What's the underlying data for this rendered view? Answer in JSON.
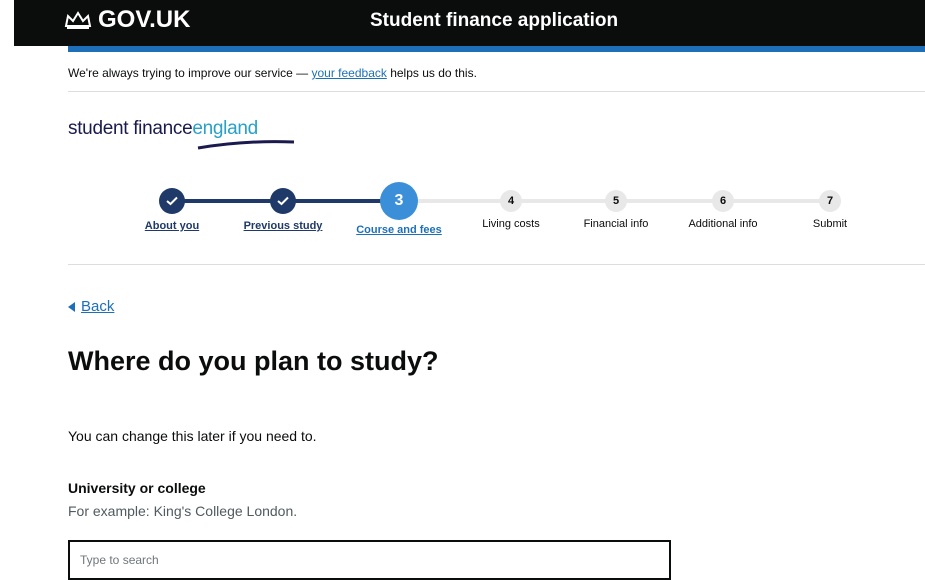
{
  "header": {
    "brand": "GOV.UK",
    "app_title": "Student finance application"
  },
  "feedback": {
    "before": "We're always trying to improve our service — ",
    "link": "your feedback",
    "after": " helps us do this."
  },
  "logo": {
    "part1": "student finance",
    "part2": "england"
  },
  "steps": [
    {
      "label": "About you",
      "state": "done",
      "number": ""
    },
    {
      "label": "Previous study",
      "state": "done",
      "number": ""
    },
    {
      "label": "Course and fees",
      "state": "current",
      "number": "3"
    },
    {
      "label": "Living costs",
      "state": "todo",
      "number": "4"
    },
    {
      "label": "Financial info",
      "state": "todo",
      "number": "5"
    },
    {
      "label": "Additional info",
      "state": "todo",
      "number": "6"
    },
    {
      "label": "Submit",
      "state": "todo",
      "number": "7"
    }
  ],
  "back": {
    "label": "Back"
  },
  "page": {
    "title": "Where do you plan to study?",
    "hint": "You can change this later if you need to.",
    "field_label": "University or college",
    "field_hint": "For example: King's College London.",
    "search_placeholder": "Type to search"
  },
  "colors": {
    "header_bg": "#0b0c0c",
    "stripe": "#1d70b8",
    "done": "#1f3a68",
    "current": "#3a8fd8",
    "todo": "#e8e8e8"
  },
  "icons": {
    "crown": "crown-icon",
    "check": "checkmark-icon",
    "back": "triangle-left-icon"
  }
}
